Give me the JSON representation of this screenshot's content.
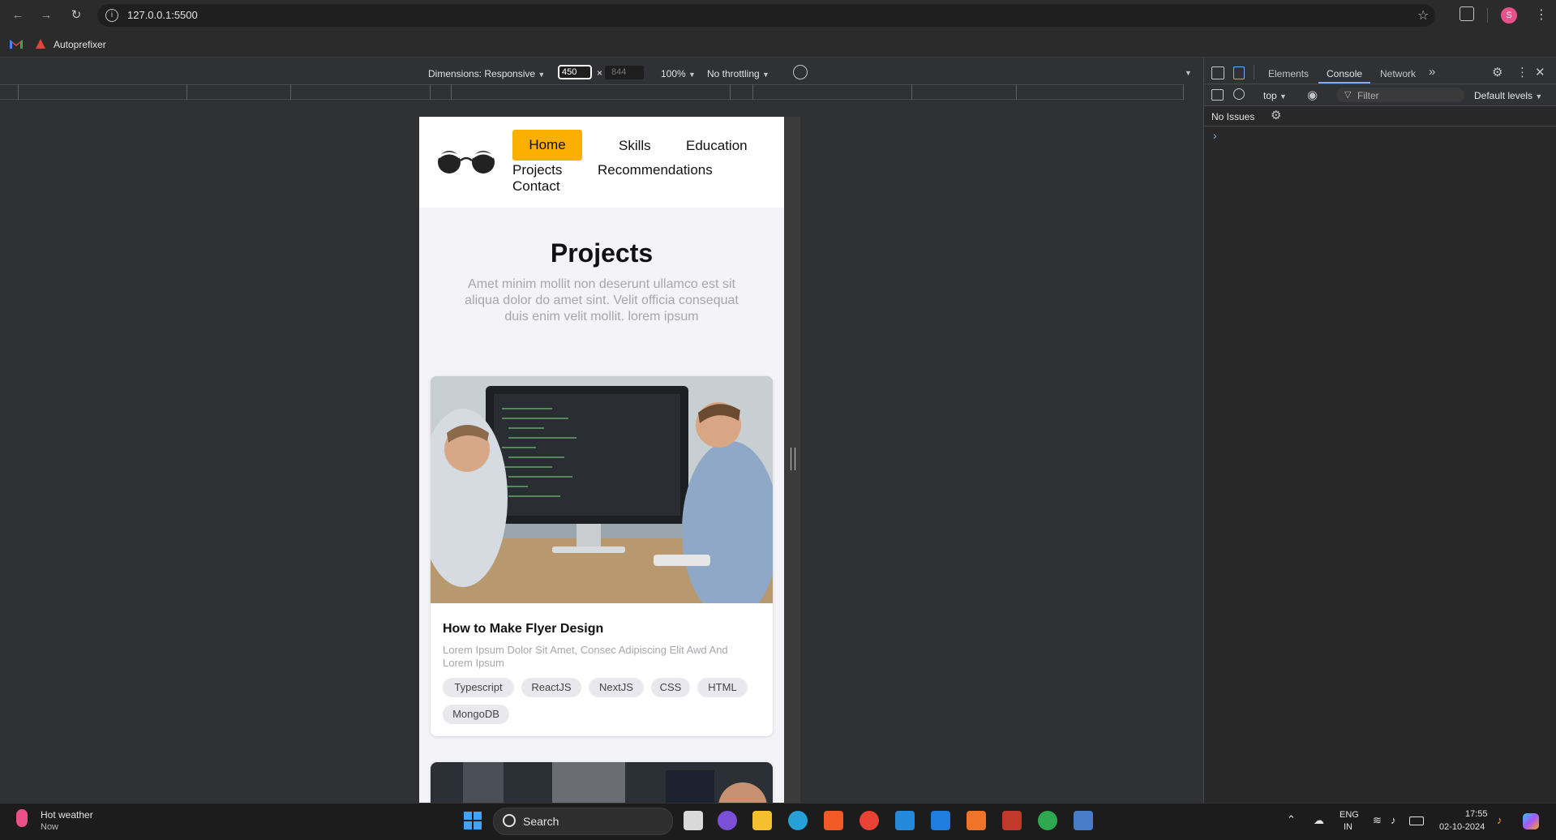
{
  "browser": {
    "url": "127.0.0.1:5500",
    "bookmarks": [
      {
        "label": "Autoprefixer"
      }
    ]
  },
  "device_toolbar": {
    "dimensions_label": "Dimensions: Responsive",
    "width_value": "450",
    "height_value": "844",
    "times": "×",
    "zoom": "100%",
    "throttling": "No throttling"
  },
  "page": {
    "nav": {
      "home": "Home",
      "skills": "Skills",
      "education": "Education",
      "projects": "Projects",
      "recommendations": "Recommendations",
      "contact": "Contact",
      "accent_color": "#fbb000"
    },
    "hero": {
      "title": "Projects",
      "subtitle": "Amet minim mollit non deserunt ullamco est sit aliqua dolor do amet sint. Velit officia consequat duis enim velit mollit. lorem ipsum"
    },
    "cards": [
      {
        "title": "How to Make Flyer Design",
        "description": "Lorem Ipsum Dolor Sit Amet, Consec Adipiscing Elit Awd And Lorem Ipsum",
        "tags": [
          "Typescript",
          "ReactJS",
          "NextJS",
          "CSS",
          "HTML",
          "MongoDB"
        ]
      }
    ]
  },
  "devtools": {
    "tabs": [
      "Elements",
      "Console",
      "Network"
    ],
    "active_tab": "Console",
    "context": "top",
    "filter_placeholder": "Filter",
    "levels": "Default levels",
    "issues": "No Issues",
    "prompt": "›"
  },
  "taskbar": {
    "weather_title": "Hot weather",
    "weather_sub": "Now",
    "search": "Search",
    "lang": "ENG",
    "region": "IN",
    "time": "17:55",
    "date": "02-10-2024"
  }
}
